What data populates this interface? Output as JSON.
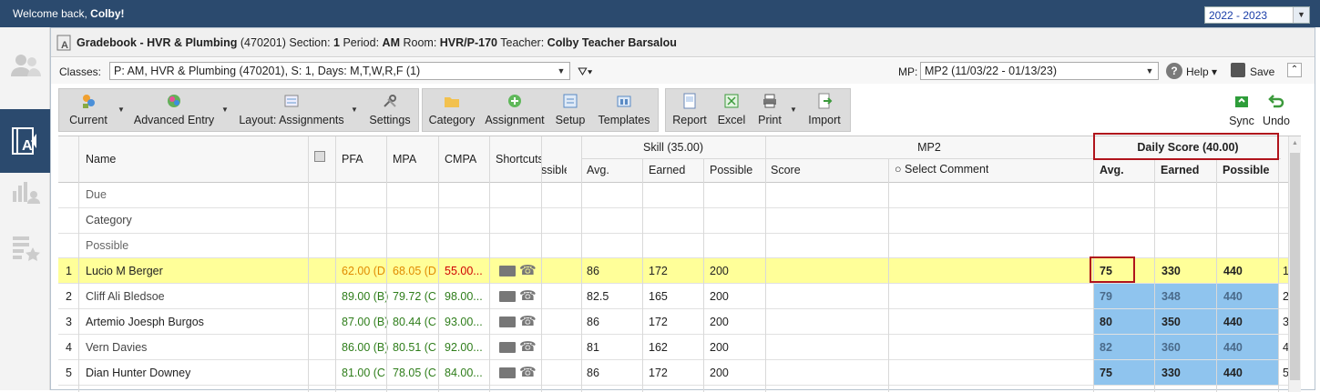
{
  "topbar": {
    "welcome_prefix": "Welcome back, ",
    "user": "Colby!",
    "year": "2022 - 2023"
  },
  "title": {
    "prefix": "Gradebook - HVR & Plumbing",
    "course": " (470201) Section: ",
    "section": "1",
    "period_lbl": " Period: ",
    "period": "AM",
    "room_lbl": " Room: ",
    "room": "HVR/P-170",
    "teacher_lbl": " Teacher: ",
    "teacher": "Colby Teacher Barsalou"
  },
  "classes": {
    "label": "Classes:",
    "value": "P: AM, HVR & Plumbing (470201), S: 1, Days: M,T,W,R,F (1)",
    "mp_label": "MP:",
    "mp_value": "MP2 (11/03/22 - 01/13/23)",
    "help": "Help",
    "save": "Save"
  },
  "toolbar": {
    "current": "Current",
    "advanced": "Advanced Entry",
    "layout": "Layout: Assignments",
    "settings": "Settings",
    "category": "Category",
    "assignment": "Assignment",
    "setup": "Setup",
    "templates": "Templates",
    "report": "Report",
    "excel": "Excel",
    "print": "Print",
    "import": "Import",
    "sync": "Sync",
    "undo": "Undo"
  },
  "columns": {
    "name": "Name",
    "pfa": "PFA",
    "mpa": "MPA",
    "cmpa": "CMPA",
    "shortcuts": "Shortcuts",
    "possible_cut": "ssible",
    "skill": "Skill (35.00)",
    "skill_avg": "Avg.",
    "skill_earned": "Earned",
    "skill_possible": "Possible",
    "mp2": "MP2",
    "mp2_score": "Score",
    "mp2_comment": "Select Comment",
    "daily": "Daily Score (40.00)",
    "daily_avg": "Avg.",
    "daily_earned": "Earned",
    "daily_possible": "Possible"
  },
  "meta_rows": [
    "Due",
    "Category",
    "Possible"
  ],
  "students": [
    {
      "num": "1",
      "name": "Lucio M Berger",
      "pfa": "62.00 (D",
      "mpa": "68.05 (D",
      "cmpa": "55.00...",
      "s_avg": "86",
      "s_earned": "172",
      "s_possible": "200",
      "d_avg": "75",
      "d_earned": "330",
      "d_possible": "440",
      "rn": "1"
    },
    {
      "num": "2",
      "name": "Cliff Ali Bledsoe",
      "pfa": "89.00 (B)",
      "mpa": "79.72 (C",
      "cmpa": "98.00...",
      "s_avg": "82.5",
      "s_earned": "165",
      "s_possible": "200",
      "d_avg": "79",
      "d_earned": "348",
      "d_possible": "440",
      "rn": "2"
    },
    {
      "num": "3",
      "name": "Artemio Joesph Burgos",
      "pfa": "87.00 (B)",
      "mpa": "80.44 (C",
      "cmpa": "93.00...",
      "s_avg": "86",
      "s_earned": "172",
      "s_possible": "200",
      "d_avg": "80",
      "d_earned": "350",
      "d_possible": "440",
      "rn": "3"
    },
    {
      "num": "4",
      "name": "Vern Davies",
      "pfa": "86.00 (B)",
      "mpa": "80.51 (C",
      "cmpa": "92.00...",
      "s_avg": "81",
      "s_earned": "162",
      "s_possible": "200",
      "d_avg": "82",
      "d_earned": "360",
      "d_possible": "440",
      "rn": "4"
    },
    {
      "num": "5",
      "name": "Dian Hunter Downey",
      "pfa": "81.00 (C",
      "mpa": "78.05 (C",
      "cmpa": "84.00...",
      "s_avg": "86",
      "s_earned": "172",
      "s_possible": "200",
      "d_avg": "75",
      "d_earned": "330",
      "d_possible": "440",
      "rn": "5"
    }
  ],
  "colors": {
    "header": "#2b4a6e",
    "highlight_row": "#ffff99",
    "daily_cells": "#8fc4ee",
    "callout": "#b0141c"
  }
}
